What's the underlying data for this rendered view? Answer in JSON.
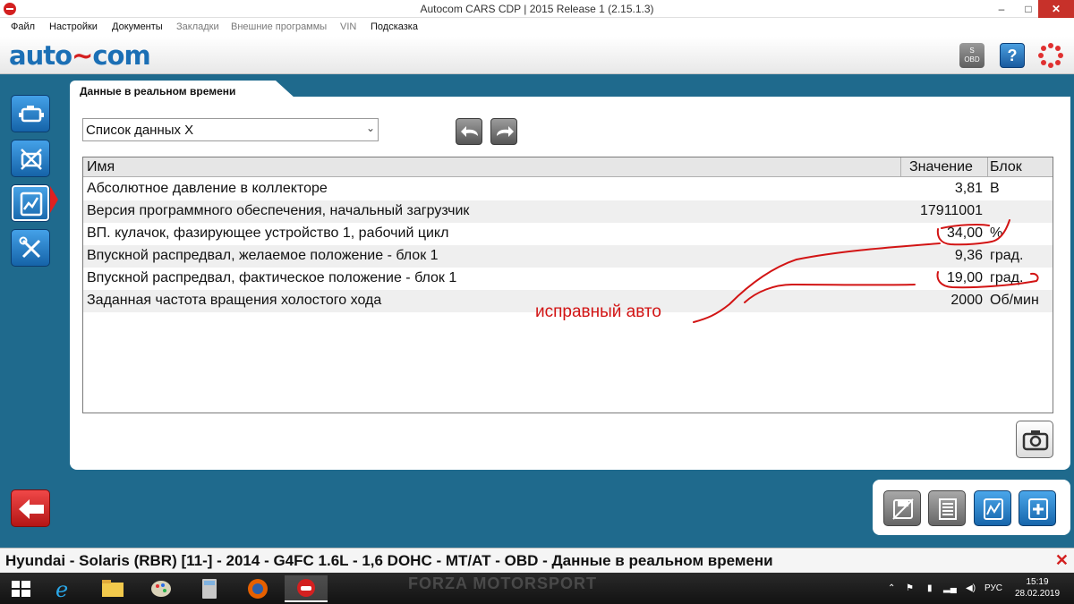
{
  "window": {
    "title": "Autocom CARS CDP | 2015 Release 1 (2.15.1.3)",
    "minimize": "–",
    "maximize": "□",
    "close": "✕"
  },
  "menu": [
    {
      "label": "Файл",
      "enabled": true
    },
    {
      "label": "Настройки",
      "enabled": true
    },
    {
      "label": "Документы",
      "enabled": true
    },
    {
      "label": "Закладки",
      "enabled": false
    },
    {
      "label": "Внешние программы",
      "enabled": false
    },
    {
      "label": "VIN",
      "enabled": false
    },
    {
      "label": "Подсказка",
      "enabled": true
    }
  ],
  "header": {
    "logo_left": "auto",
    "logo_mid": "~",
    "logo_right": "com",
    "obd_label_top": "S",
    "obd_label_bottom": "OBD",
    "help_label": "?"
  },
  "tab": {
    "label": "Данные в реальном времени"
  },
  "select": {
    "value": "Список данных X"
  },
  "table": {
    "headers": {
      "name": "Имя",
      "value": "Значение",
      "unit": "Блок"
    },
    "rows": [
      {
        "name": "Абсолютное давление в коллекторе",
        "value": "3,81",
        "unit": "В"
      },
      {
        "name": "Версия программного обеспечения, начальный загрузчик",
        "value": "17911001",
        "unit": ""
      },
      {
        "name": "ВП. кулачок, фазирующее устройство 1, рабочий цикл",
        "value": "34,00",
        "unit": "%"
      },
      {
        "name": "Впускной распредвал, желаемое положение - блок 1",
        "value": "9,36",
        "unit": "град."
      },
      {
        "name": "Впускной распредвал, фактическое положение - блок 1",
        "value": "19,00",
        "unit": "град."
      },
      {
        "name": "Заданная частота вращения холостого хода",
        "value": "2000",
        "unit": "Об/мин"
      }
    ]
  },
  "annotation": {
    "text": "исправный авто",
    "color": "#d21414"
  },
  "status": {
    "text": "Hyundai - Solaris (RBR) [11-] - 2014 - G4FC 1.6L - 1,6 DOHC - MT/AT - OBD - Данные в реальном времени",
    "close": "✕"
  },
  "taskbar": {
    "wallpaper_text": "FORZA MOTORSPORT",
    "language": "РУС",
    "time": "15:19",
    "date": "28.02.2019"
  },
  "colors": {
    "accent": "#1f6a8d",
    "button_blue": "#1766ab",
    "alert_red": "#e02020"
  }
}
